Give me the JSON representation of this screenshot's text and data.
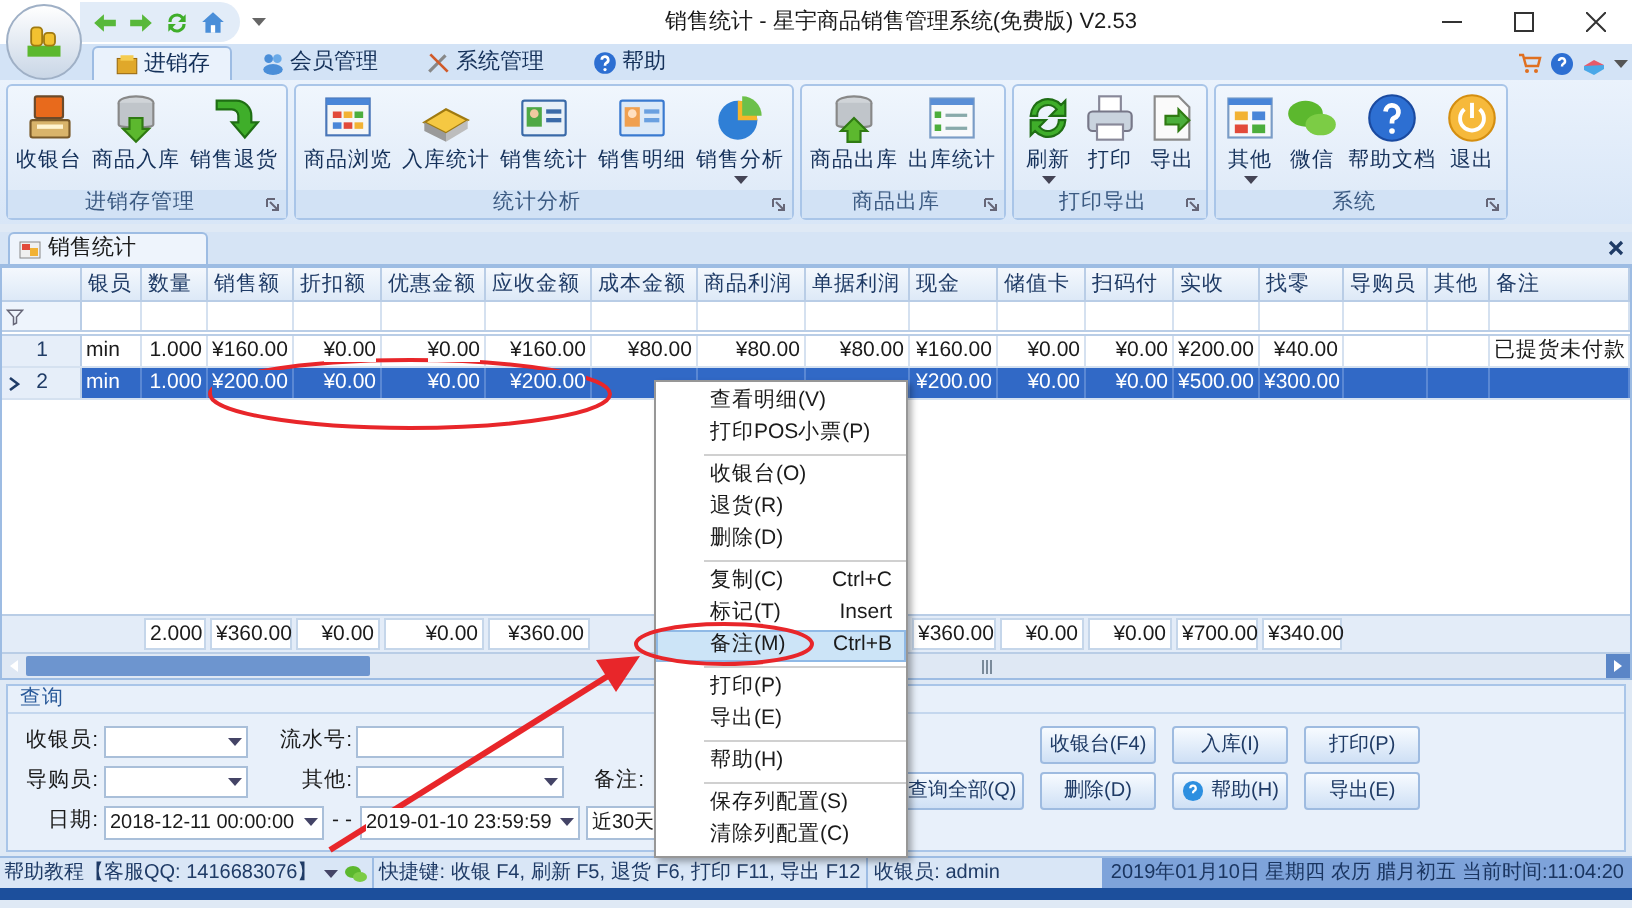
{
  "window": {
    "title": "销售统计 - 星宇商品销售管理系统(免费版) V2.53"
  },
  "ribbon": {
    "tabs": [
      {
        "label": "进销存",
        "selected": true
      },
      {
        "label": "会员管理",
        "selected": false
      },
      {
        "label": "系统管理",
        "selected": false
      },
      {
        "label": "帮助",
        "selected": false
      }
    ],
    "groups": [
      {
        "title": "进销存管理",
        "buttons": [
          {
            "label": "收银台",
            "dropdown": false
          },
          {
            "label": "商品入库",
            "dropdown": false
          },
          {
            "label": "销售退货",
            "dropdown": false
          }
        ]
      },
      {
        "title": "统计分析",
        "buttons": [
          {
            "label": "商品浏览",
            "dropdown": false
          },
          {
            "label": "入库统计",
            "dropdown": false
          },
          {
            "label": "销售统计",
            "dropdown": false
          },
          {
            "label": "销售明细",
            "dropdown": false
          },
          {
            "label": "销售分析",
            "dropdown": true
          }
        ]
      },
      {
        "title": "商品出库",
        "buttons": [
          {
            "label": "商品出库",
            "dropdown": false
          },
          {
            "label": "出库统计",
            "dropdown": false
          }
        ]
      },
      {
        "title": "打印导出",
        "buttons": [
          {
            "label": "刷新",
            "dropdown": true
          },
          {
            "label": "打印",
            "dropdown": false
          },
          {
            "label": "导出",
            "dropdown": false
          }
        ]
      },
      {
        "title": "系统",
        "buttons": [
          {
            "label": "其他",
            "dropdown": true
          },
          {
            "label": "微信",
            "dropdown": false
          },
          {
            "label": "帮助文档",
            "dropdown": false
          },
          {
            "label": "退出",
            "dropdown": false
          }
        ]
      }
    ]
  },
  "document_tab": {
    "label": "销售统计"
  },
  "grid": {
    "columns": [
      "银员",
      "数量",
      "销售额",
      "折扣额",
      "优惠金额",
      "应收金额",
      "成本金额",
      "商品利润",
      "单据利润",
      "现金",
      "储值卡",
      "扫码付",
      "实收",
      "找零",
      "导购员",
      "其他",
      "备注"
    ],
    "rows": [
      {
        "number": "1",
        "selected": false,
        "current": false,
        "cells": [
          "min",
          "1.000",
          "¥160.00",
          "¥0.00",
          "¥0.00",
          "¥160.00",
          "¥80.00",
          "¥80.00",
          "¥80.00",
          "¥160.00",
          "¥0.00",
          "¥0.00",
          "¥200.00",
          "¥40.00",
          null,
          null,
          "已提货未付款"
        ]
      },
      {
        "number": "2",
        "selected": true,
        "current": true,
        "cells": [
          "min",
          "1.000",
          "¥200.00",
          "¥0.00",
          "¥0.00",
          "¥200.00",
          null,
          null,
          null,
          "¥200.00",
          "¥0.00",
          "¥0.00",
          "¥500.00",
          "¥300.00",
          null,
          null,
          null
        ]
      }
    ],
    "totals": [
      {
        "kind": "blank"
      },
      {
        "kind": "value",
        "value": "2.000"
      },
      {
        "kind": "value",
        "value": "¥360.00"
      },
      {
        "kind": "value",
        "value": "¥0.00"
      },
      {
        "kind": "value",
        "value": "¥0.00"
      },
      {
        "kind": "value",
        "value": "¥360.00"
      },
      {
        "kind": "blank"
      },
      {
        "kind": "blank"
      },
      {
        "kind": "blank"
      },
      {
        "kind": "value",
        "value": "¥360.00"
      },
      {
        "kind": "value",
        "value": "¥0.00"
      },
      {
        "kind": "value",
        "value": "¥0.00"
      },
      {
        "kind": "value",
        "value": "¥700.00"
      },
      {
        "kind": "value",
        "value": "¥340.00"
      }
    ]
  },
  "context_menu": {
    "items": [
      {
        "kind": "item",
        "label": "查看明细(V)",
        "highlighted": false
      },
      {
        "kind": "item",
        "label": "打印POS小票(P)",
        "highlighted": false
      },
      {
        "kind": "separator"
      },
      {
        "kind": "item",
        "label": "收银台(O)",
        "highlighted": false
      },
      {
        "kind": "item",
        "label": "退货(R)",
        "highlighted": false
      },
      {
        "kind": "item",
        "label": "删除(D)",
        "highlighted": false
      },
      {
        "kind": "separator"
      },
      {
        "kind": "item",
        "label": "复制(C)",
        "shortcut": "Ctrl+C",
        "highlighted": false
      },
      {
        "kind": "item",
        "label": "标记(T)",
        "shortcut": "Insert",
        "highlighted": false
      },
      {
        "kind": "item",
        "label": "备注(M)",
        "shortcut": "Ctrl+B",
        "highlighted": true
      },
      {
        "kind": "separator"
      },
      {
        "kind": "item",
        "label": "打印(P)",
        "highlighted": false
      },
      {
        "kind": "item",
        "label": "导出(E)",
        "highlighted": false
      },
      {
        "kind": "separator"
      },
      {
        "kind": "item",
        "label": "帮助(H)",
        "highlighted": false
      },
      {
        "kind": "separator"
      },
      {
        "kind": "item",
        "label": "保存列配置(S)",
        "highlighted": false
      },
      {
        "kind": "item",
        "label": "清除列配置(C)",
        "highlighted": false
      }
    ]
  },
  "query": {
    "title": "查询",
    "cashier_label": "收银员:",
    "serial_label": "流水号:",
    "guide_label": "导购员:",
    "other_label": "其他:",
    "note_label": "备注:",
    "date": {
      "label": "日期:",
      "from": "2018-12-11 00:00:00",
      "separator": "- -",
      "to": "2019-01-10 23:59:59",
      "range": "近30天"
    },
    "buttons": [
      {
        "label": "收银台(F4)",
        "kind": "plain"
      },
      {
        "label": "入库(I)",
        "kind": "plain"
      },
      {
        "label": "打印(P)",
        "kind": "plain"
      },
      {
        "label": "查询全部(Q)",
        "kind": "plain"
      },
      {
        "label": "删除(D)",
        "kind": "plain"
      },
      {
        "label": "帮助(H)",
        "kind": "help"
      },
      {
        "label": "导出(E)",
        "kind": "plain"
      }
    ]
  },
  "status_bar": {
    "help": "帮助教程【客服QQ: 1416683076】",
    "shortcuts": "快捷键: 收银 F4, 刷新 F5, 退货 F6, 打印 F11, 导出 F12",
    "cashier": "收银员: admin",
    "datetime": "2019年01月10日 星期四 农历 腊月初五 当前时间:11:04:20"
  }
}
